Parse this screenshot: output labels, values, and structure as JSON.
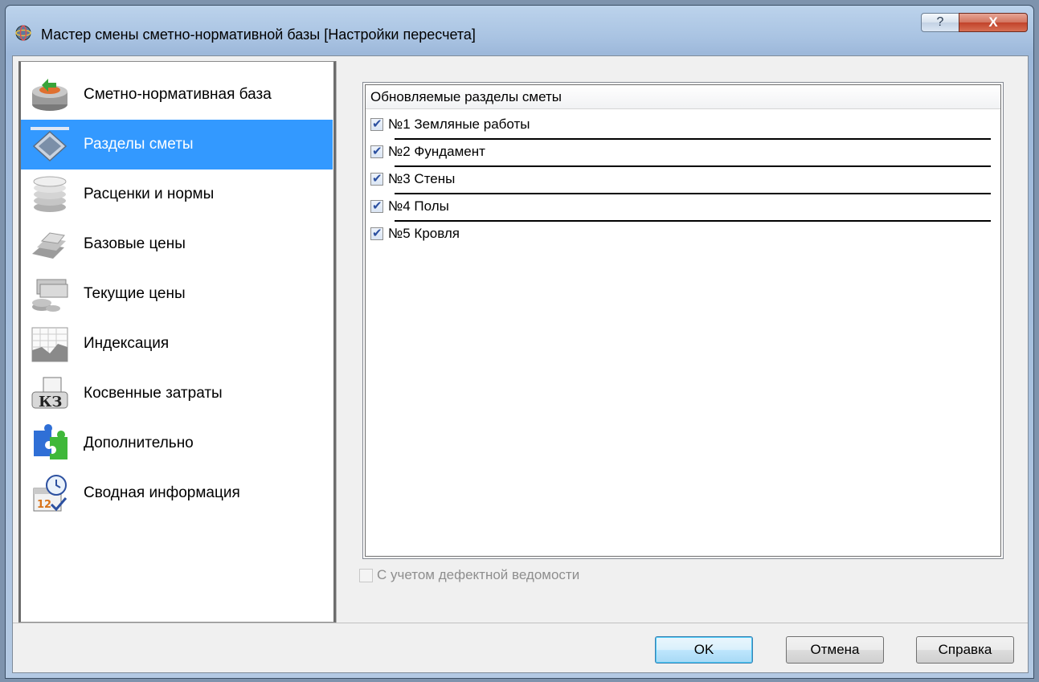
{
  "window": {
    "title": "Мастер смены сметно-нормативной базы [Настройки пересчета]",
    "help_glyph": "?",
    "close_glyph": "X"
  },
  "sidebar": {
    "items": [
      {
        "label": "Сметно-нормативная база",
        "icon": "database-icon",
        "selected": false
      },
      {
        "label": "Разделы сметы",
        "icon": "sections-icon",
        "selected": true
      },
      {
        "label": "Расценки и нормы",
        "icon": "coins-stack-icon",
        "selected": false
      },
      {
        "label": "Базовые цены",
        "icon": "gold-bars-icon",
        "selected": false
      },
      {
        "label": "Текущие цены",
        "icon": "money-icon",
        "selected": false
      },
      {
        "label": "Индексация",
        "icon": "chart-icon",
        "selected": false
      },
      {
        "label": "Косвенные затраты",
        "icon": "indirect-costs-icon",
        "selected": false
      },
      {
        "label": "Дополнительно",
        "icon": "puzzle-icon",
        "selected": false
      },
      {
        "label": "Сводная информация",
        "icon": "calendar-clock-icon",
        "selected": false
      }
    ]
  },
  "sections_list": {
    "header": "Обновляемые разделы сметы",
    "rows": [
      {
        "label": "№1 Земляные работы",
        "checked": true
      },
      {
        "label": "№2 Фундамент",
        "checked": true
      },
      {
        "label": "№3 Стены",
        "checked": true
      },
      {
        "label": "№4 Полы",
        "checked": true
      },
      {
        "label": "№5 Кровля",
        "checked": true
      }
    ]
  },
  "defect_option": {
    "label": "С учетом дефектной ведомости",
    "checked": false,
    "enabled": false
  },
  "buttons": {
    "ok": "OK",
    "cancel": "Отмена",
    "help": "Справка"
  },
  "colors": {
    "selection": "#3399ff",
    "title_bar": "#a9c3e2",
    "close_button": "#c2422a"
  }
}
